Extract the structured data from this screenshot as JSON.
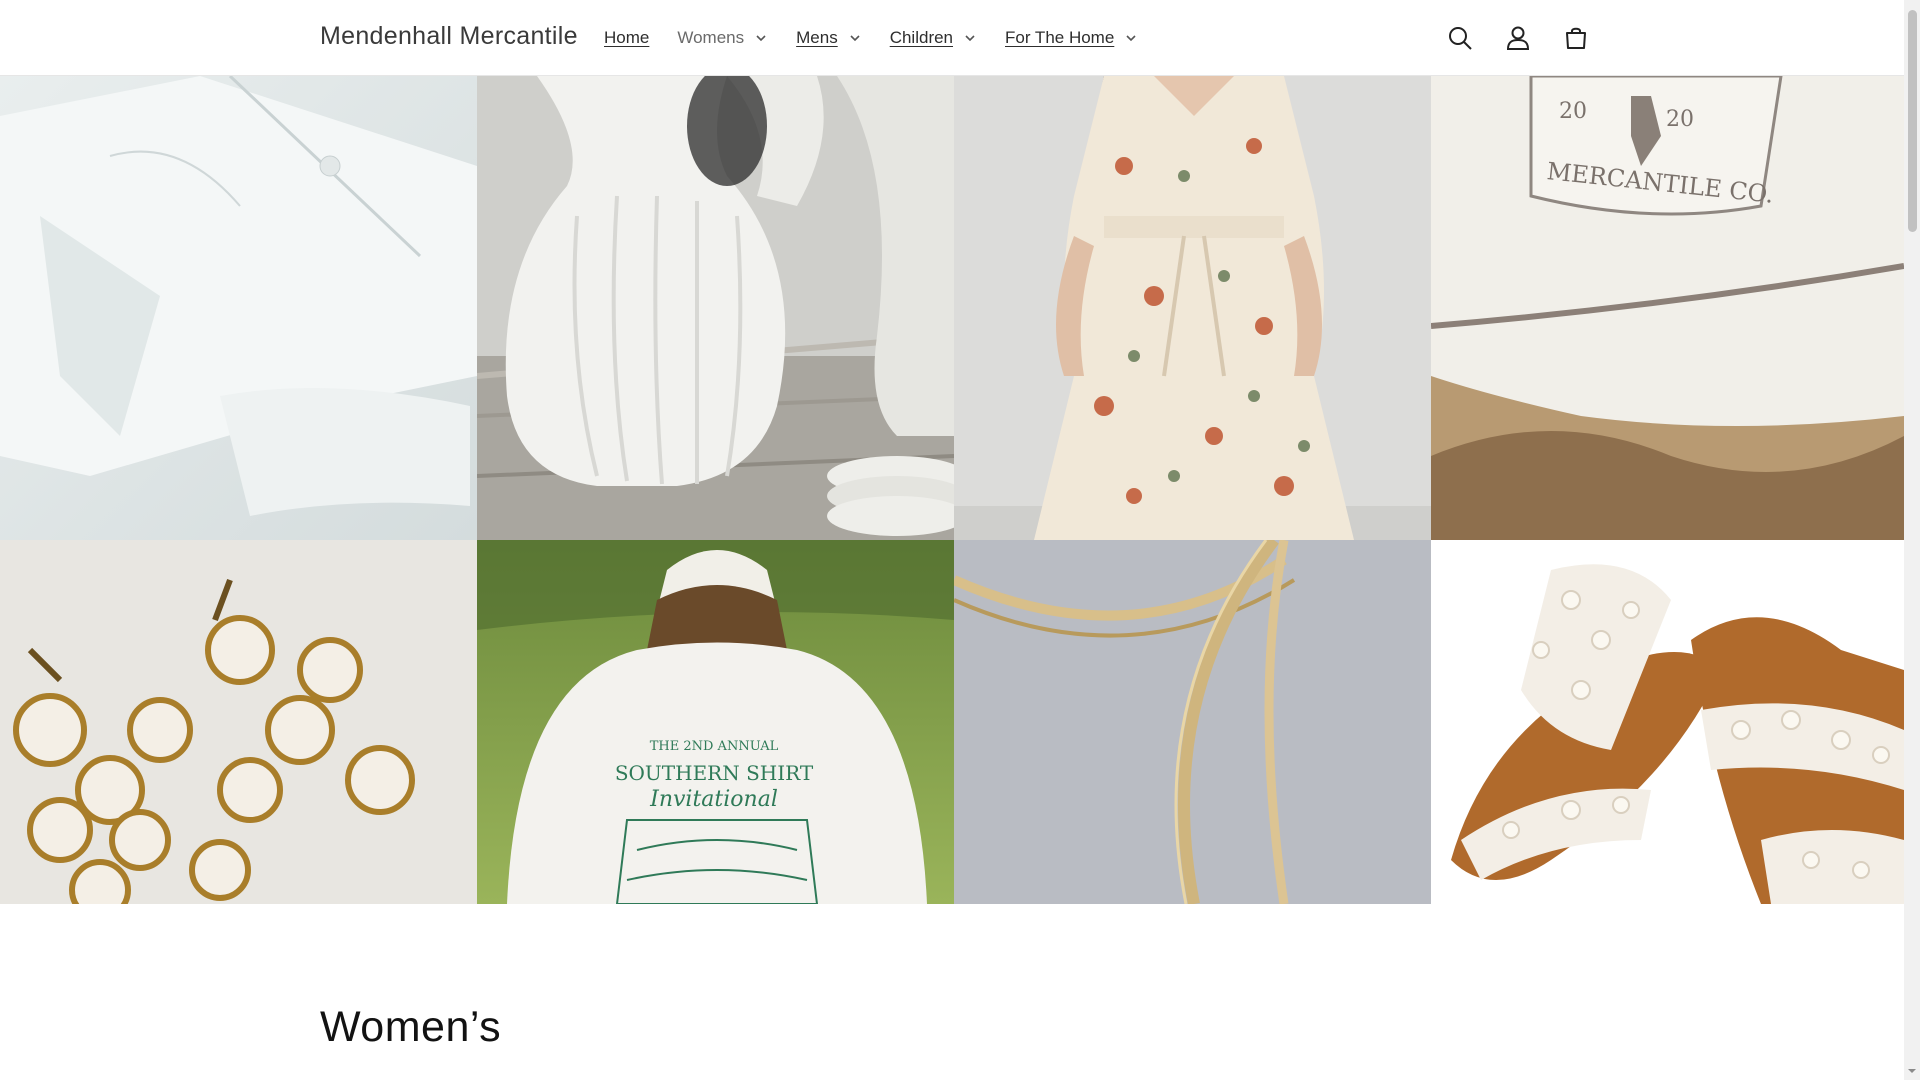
{
  "header": {
    "brand": "Mendenhall Mercantile",
    "nav": [
      {
        "label": "Home"
      },
      {
        "label": "Womens"
      },
      {
        "label": "Mens"
      },
      {
        "label": "Children"
      },
      {
        "label": "For The Home"
      }
    ],
    "icons": [
      "search-icon",
      "account-icon",
      "cart-icon"
    ]
  },
  "hero": {
    "tiles": [
      {
        "subject": "white blouse sleeve"
      },
      {
        "subject": "white ceramic pitcher"
      },
      {
        "subject": "floral maxi dress"
      },
      {
        "subject": "embroidered cap"
      },
      {
        "subject": "pearl cluster earrings"
      },
      {
        "subject": "shirt back print"
      },
      {
        "subject": "gold chain necklaces"
      },
      {
        "subject": "pearl embellished sandals"
      }
    ],
    "hat_text": {
      "line1": "20",
      "line2": "20",
      "line3": "MERCANTILE CO."
    },
    "shirt_text": {
      "line1": "THE 2ND ANNUAL",
      "line2": "SOUTHERN SHIRT",
      "line3": "Invitational"
    }
  },
  "section": {
    "title": "Women’s"
  },
  "colors": {
    "text": "#121212",
    "border": "#e6e6e6",
    "background": "#ffffff"
  }
}
